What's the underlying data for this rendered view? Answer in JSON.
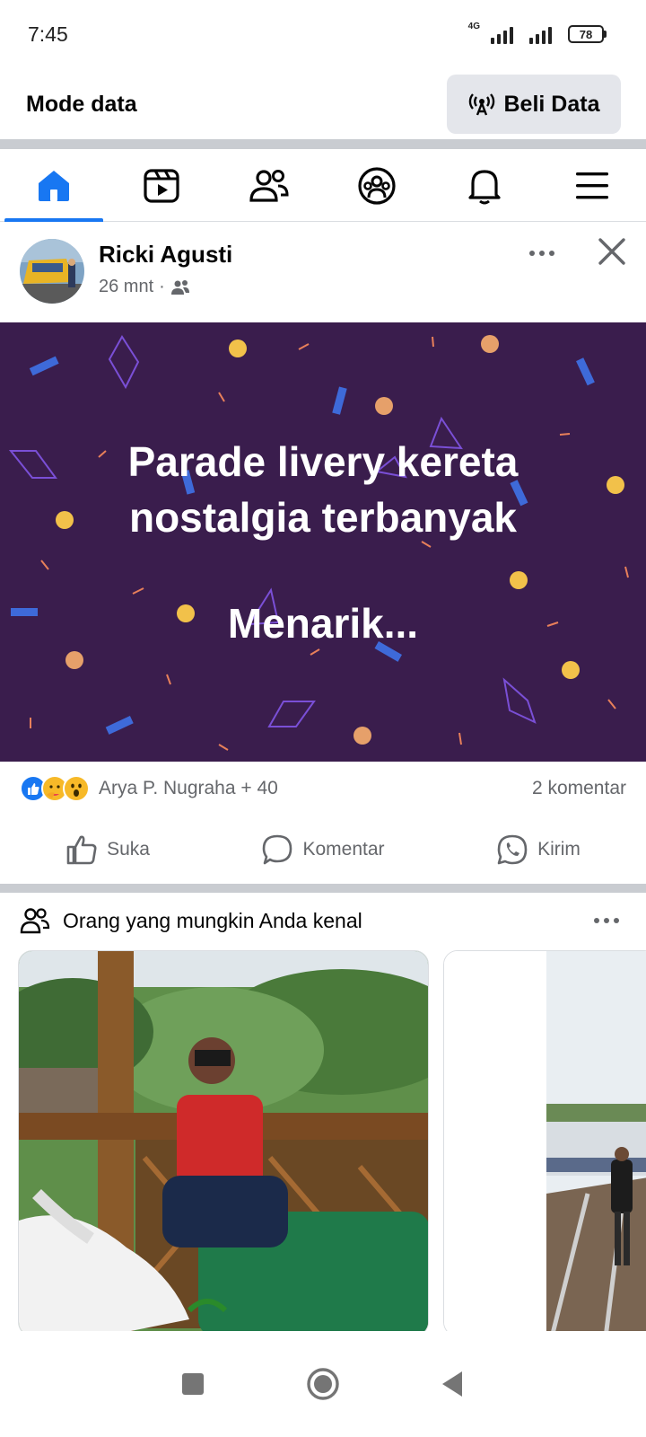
{
  "status_bar": {
    "time": "7:45",
    "network_label": "4G",
    "battery": "78"
  },
  "data_bar": {
    "label": "Mode data",
    "buy_button": "Beli Data"
  },
  "nav_tabs": [
    {
      "name": "home",
      "icon": "home-icon",
      "active": true
    },
    {
      "name": "video",
      "icon": "video-icon",
      "active": false
    },
    {
      "name": "friends",
      "icon": "friends-icon",
      "active": false
    },
    {
      "name": "groups",
      "icon": "groups-icon",
      "active": false
    },
    {
      "name": "notifications",
      "icon": "bell-icon",
      "active": false
    },
    {
      "name": "menu",
      "icon": "menu-icon",
      "active": false
    }
  ],
  "post": {
    "author": "Ricki Agusti",
    "time": "26 mnt",
    "audience_icon": "friends-audience-icon",
    "banner_line1": "Parade livery kereta",
    "banner_line2": "nostalgia terbanyak",
    "banner_line3": "Menarik...",
    "banner_color": "#3a1d4d",
    "reactions_text": "Arya P. Nugraha + 40",
    "comment_count": "2 komentar",
    "actions": {
      "like": "Suka",
      "comment": "Komentar",
      "send": "Kirim"
    }
  },
  "pymk": {
    "title": "Orang yang mungkin Anda kenal"
  },
  "colors": {
    "accent": "#1877f2",
    "secondary_text": "#65676b"
  }
}
